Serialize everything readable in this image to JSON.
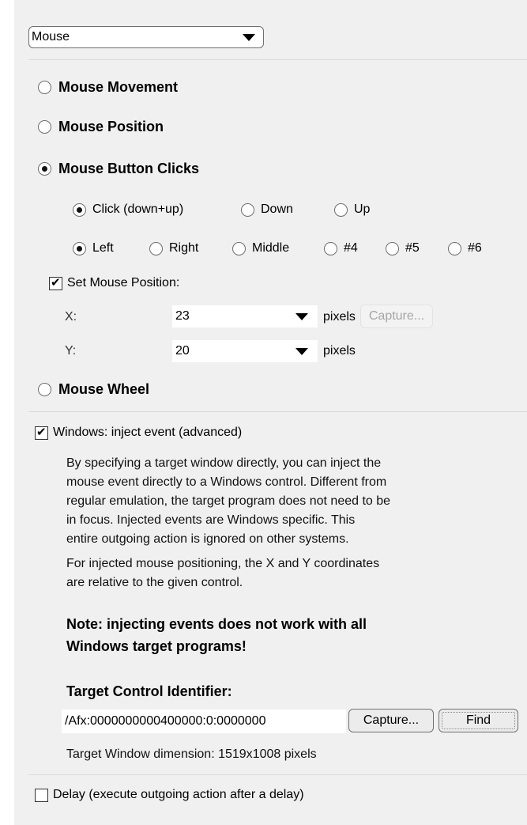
{
  "category_select": {
    "value": "Mouse"
  },
  "options": {
    "movement": "Mouse Movement",
    "position": "Mouse Position",
    "button_clicks": "Mouse Button Clicks",
    "wheel": "Mouse Wheel"
  },
  "click_type": {
    "click": "Click (down+up)",
    "down": "Down",
    "up": "Up"
  },
  "buttons": {
    "left": "Left",
    "right": "Right",
    "middle": "Middle",
    "b4": "#4",
    "b5": "#5",
    "b6": "#6"
  },
  "set_position": {
    "label": "Set Mouse Position:",
    "x_label": "X:",
    "x_value": "23",
    "y_label": "Y:",
    "y_value": "20",
    "unit": "pixels",
    "capture_label": "Capture..."
  },
  "inject": {
    "label": "Windows: inject event (advanced)",
    "desc1": [
      "By specifying a target window directly, you can inject the",
      "mouse event directly to a Windows control. Different from",
      "regular emulation, the target program does not need to be",
      "in focus. Injected events are Windows specific. This",
      "entire outgoing action is ignored on other systems."
    ],
    "desc2": [
      "For injected mouse positioning, the X and Y coordinates",
      "are relative to the given control."
    ],
    "note": [
      "Note: injecting events does not work with all",
      "Windows target programs!"
    ],
    "target_label": "Target Control Identifier:",
    "target_value": "/Afx:0000000000400000:0:0000000",
    "capture_label": "Capture...",
    "find_label": "Find",
    "dimension": "Target Window dimension: 1519x1008 pixels"
  },
  "delay": {
    "label": "Delay (execute outgoing action after a delay)"
  },
  "state": {
    "selected_option": "button_clicks",
    "click_type": "click",
    "button": "left",
    "set_position_checked": true,
    "inject_checked": true,
    "delay_checked": false
  }
}
